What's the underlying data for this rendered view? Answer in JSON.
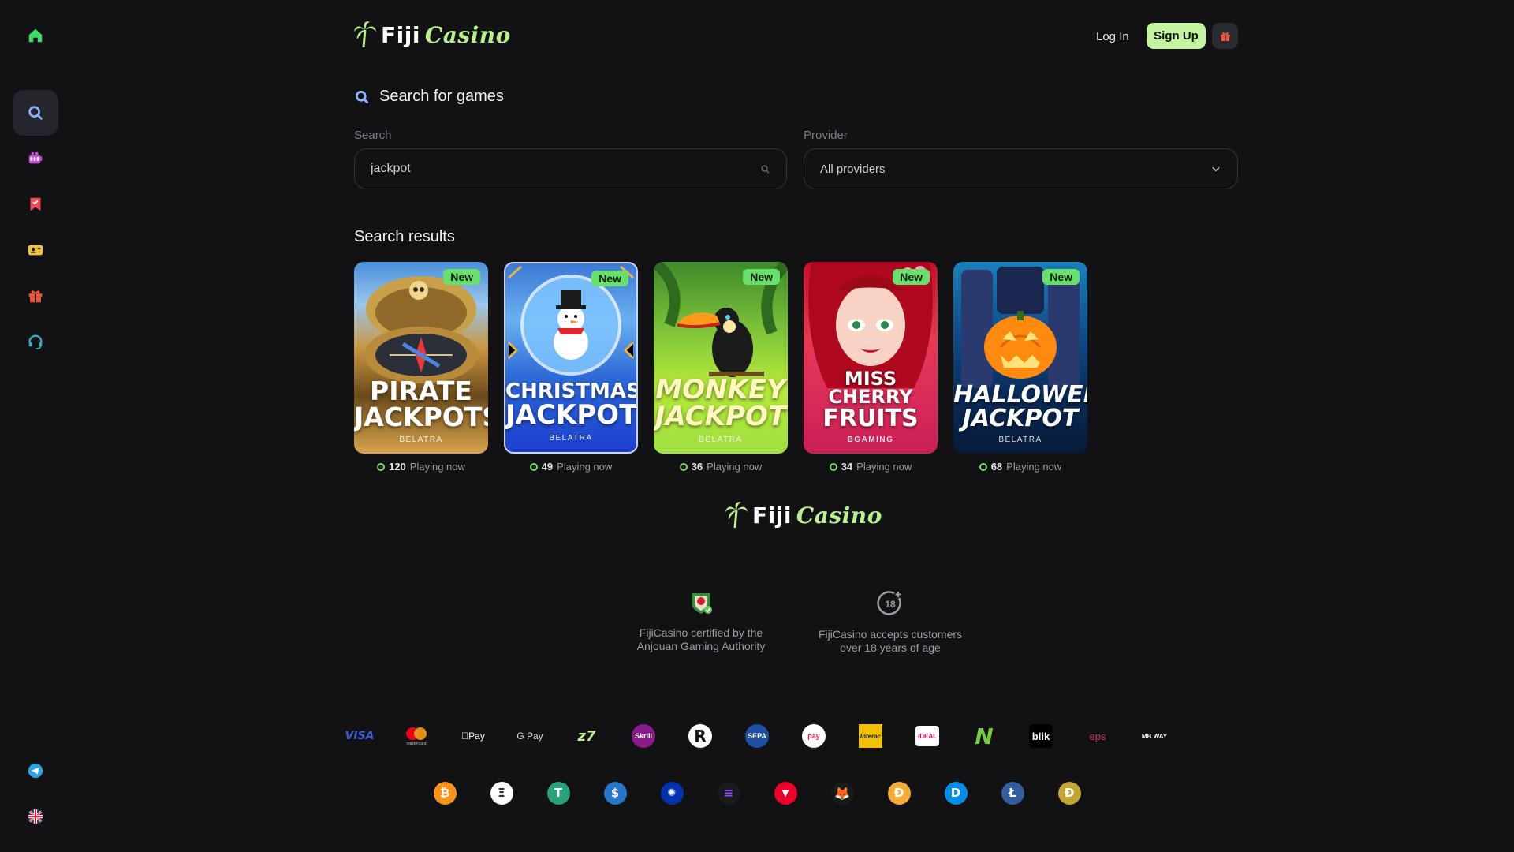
{
  "brand": {
    "word1": "Fiji",
    "word2": "Casino"
  },
  "header": {
    "login": "Log In",
    "signup": "Sign Up"
  },
  "sidebar": {
    "items": [
      "home-icon",
      "search-icon",
      "slots-icon",
      "bookmark-icon",
      "profile-card-icon",
      "gift-icon",
      "support-headset-icon",
      "telegram-icon",
      "uk-flag-icon"
    ]
  },
  "search": {
    "title": "Search for games",
    "search_label": "Search",
    "search_value": "jackpot",
    "provider_label": "Provider",
    "provider_value": "All providers"
  },
  "results": {
    "title": "Search results",
    "playing_suffix": "Playing now",
    "games": [
      {
        "title_line1": "PIRATE",
        "title_line2": "JACKPOTS",
        "provider": "BELATRA",
        "badge": "New",
        "playing": "120"
      },
      {
        "title_line1": "CHRISTMAS",
        "title_line2": "JACKPOT",
        "provider": "BELATRA",
        "badge": "New",
        "playing": "49"
      },
      {
        "title_line1": "MONKEY",
        "title_line2": "JACKPOT",
        "provider": "BELATRA",
        "badge": "New",
        "playing": "36"
      },
      {
        "title_line1": "MISS CHERRY",
        "title_line2": "FRUITS",
        "provider": "BGAMING",
        "badge": "New",
        "playing": "34"
      },
      {
        "title_line1": "HALLOWEEN",
        "title_line2": "JACKPOT",
        "provider": "BELATRA",
        "badge": "New",
        "playing": "68"
      }
    ]
  },
  "footer": {
    "cert1_line1": "FijiCasino certified by the",
    "cert1_line2": "Anjouan Gaming Authority",
    "cert2_line1": "FijiCasino accepts customers",
    "cert2_line2": "over 18 years of age",
    "age_badge": "18",
    "payments": [
      {
        "label": "VISA",
        "color": "#3a5bd9"
      },
      {
        "label": "mastercard",
        "color": "#eb001b"
      },
      {
        "label": "Pay",
        "color": "#ffffff"
      },
      {
        "label": "G Pay",
        "color": "#ffffff"
      },
      {
        "label": "z7",
        "color": "#b7f08d"
      },
      {
        "label": "Skrill",
        "color": "#8a1a8c"
      },
      {
        "label": "R",
        "color": "#ffffff"
      },
      {
        "label": "SEPA",
        "color": "#1d4fa3"
      },
      {
        "label": "pay",
        "color": "#ffffff"
      },
      {
        "label": "Interac",
        "color": "#f2c200"
      },
      {
        "label": "iDEAL",
        "color": "#cc0066"
      },
      {
        "label": "N",
        "color": "#7ac943"
      },
      {
        "label": "blik",
        "color": "#ffffff"
      },
      {
        "label": "eps",
        "color": "#c8335f"
      },
      {
        "label": "MB WAY",
        "color": "#d7182a"
      }
    ],
    "cryptos": [
      {
        "label": "₿",
        "color": "#f7931a"
      },
      {
        "label": "Ξ",
        "color": "#ffffff"
      },
      {
        "label": "T",
        "color": "#26a17b"
      },
      {
        "label": "$",
        "color": "#2775ca"
      },
      {
        "label": "✺",
        "color": "#0033ad"
      },
      {
        "label": "≡",
        "color": "#1a1a1a"
      },
      {
        "label": "▼",
        "color": "#eb0029"
      },
      {
        "label": "🦊",
        "color": "#1a1a1a"
      },
      {
        "label": "Ð",
        "color": "#f5ac37"
      },
      {
        "label": "D",
        "color": "#008ce7"
      },
      {
        "label": "Ł",
        "color": "#345d9d"
      },
      {
        "label": "Ð",
        "color": "#c2a633"
      }
    ]
  }
}
